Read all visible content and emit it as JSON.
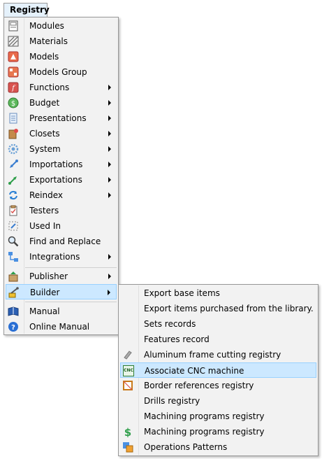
{
  "menubar": {
    "title": "Registry"
  },
  "main_menu": {
    "items": [
      {
        "label": "Modules",
        "icon": "modules-icon",
        "submenu": false
      },
      {
        "label": "Materials",
        "icon": "materials-icon",
        "submenu": false
      },
      {
        "label": "Models",
        "icon": "models-icon",
        "submenu": false
      },
      {
        "label": "Models Group",
        "icon": "models-group-icon",
        "submenu": false
      },
      {
        "label": "Functions",
        "icon": "functions-icon",
        "submenu": true
      },
      {
        "label": "Budget",
        "icon": "budget-icon",
        "submenu": true
      },
      {
        "label": "Presentations",
        "icon": "presentations-icon",
        "submenu": true
      },
      {
        "label": "Closets",
        "icon": "closets-icon",
        "submenu": true
      },
      {
        "label": "System",
        "icon": "system-gear-icon",
        "submenu": true
      },
      {
        "label": "Importations",
        "icon": "importations-icon",
        "submenu": true
      },
      {
        "label": "Exportations",
        "icon": "exportations-icon",
        "submenu": true
      },
      {
        "label": "Reindex",
        "icon": "reindex-icon",
        "submenu": true
      },
      {
        "label": "Testers",
        "icon": "testers-icon",
        "submenu": false
      },
      {
        "label": "Used In",
        "icon": "used-in-icon",
        "submenu": false
      },
      {
        "label": "Find and Replace",
        "icon": "magnifier-icon",
        "submenu": false
      },
      {
        "label": "Integrations",
        "icon": "integrations-icon",
        "submenu": true
      },
      {
        "label": "Publisher",
        "icon": "publisher-icon",
        "submenu": true
      },
      {
        "label": "Builder",
        "icon": "builder-icon",
        "submenu": true,
        "highlighted": true
      },
      {
        "label": "Manual",
        "icon": "manual-book-icon",
        "submenu": false
      },
      {
        "label": "Online Manual",
        "icon": "help-icon",
        "submenu": false
      }
    ]
  },
  "sub_menu": {
    "items": [
      {
        "label": "Export base items",
        "icon": ""
      },
      {
        "label": "Export items purchased from the library.",
        "icon": ""
      },
      {
        "label": "Sets records",
        "icon": ""
      },
      {
        "label": "Features record",
        "icon": ""
      },
      {
        "label": "Aluminum frame cutting registry",
        "icon": "aluminum-frame-icon"
      },
      {
        "label": "Associate CNC machine",
        "icon": "cnc-icon",
        "highlighted": true,
        "icon_text": "CNC"
      },
      {
        "label": "Border references registry",
        "icon": "border-references-icon"
      },
      {
        "label": "Drills registry",
        "icon": ""
      },
      {
        "label": "Machining programs registry",
        "icon": ""
      },
      {
        "label": "Machining programs registry",
        "icon": "dollar-icon"
      },
      {
        "label": "Operations Patterns",
        "icon": "operations-patterns-icon"
      }
    ]
  },
  "colors": {
    "highlight_bg": "#cce8ff",
    "highlight_border": "#99d1ff",
    "menu_bg": "#f2f2f2",
    "menubar_tab_bg": "#e5f1fb"
  }
}
